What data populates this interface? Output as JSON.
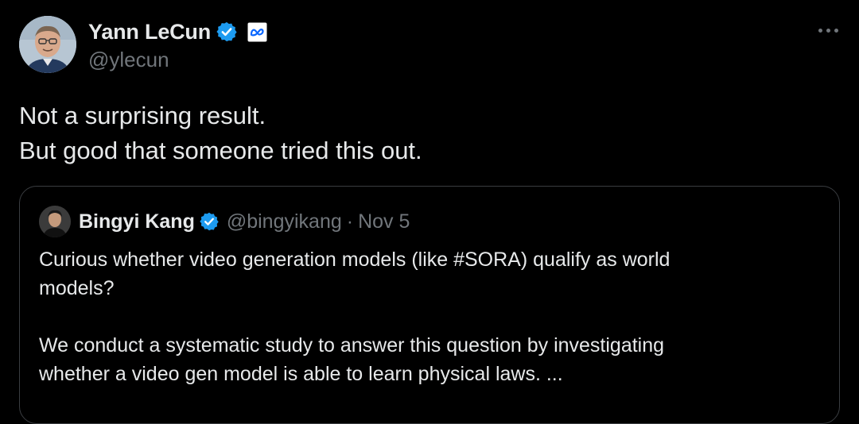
{
  "author": {
    "display_name": "Yann LeCun",
    "handle": "@ylecun",
    "verified": true,
    "affiliation_badge": "meta-icon"
  },
  "tweet": {
    "lines": [
      "Not a surprising result.",
      "But good that someone tried this out."
    ]
  },
  "quoted": {
    "display_name": "Bingyi Kang",
    "handle": "@bingyikang",
    "separator": "·",
    "date": "Nov 5",
    "verified": true,
    "text_lines_1": [
      "Curious whether video generation models (like #SORA) qualify as world",
      "models?"
    ],
    "text_lines_2": [
      "We conduct a systematic study to answer this question by investigating",
      "whether a video gen model is able to learn physical laws. ..."
    ]
  },
  "colors": {
    "background": "#000000",
    "text_primary": "#e7e9ea",
    "text_secondary": "#71767b",
    "verified_blue": "#1d9bf0",
    "border": "#3a3d41"
  },
  "icons": [
    "verified-badge-icon",
    "meta-icon",
    "more-options-icon"
  ]
}
